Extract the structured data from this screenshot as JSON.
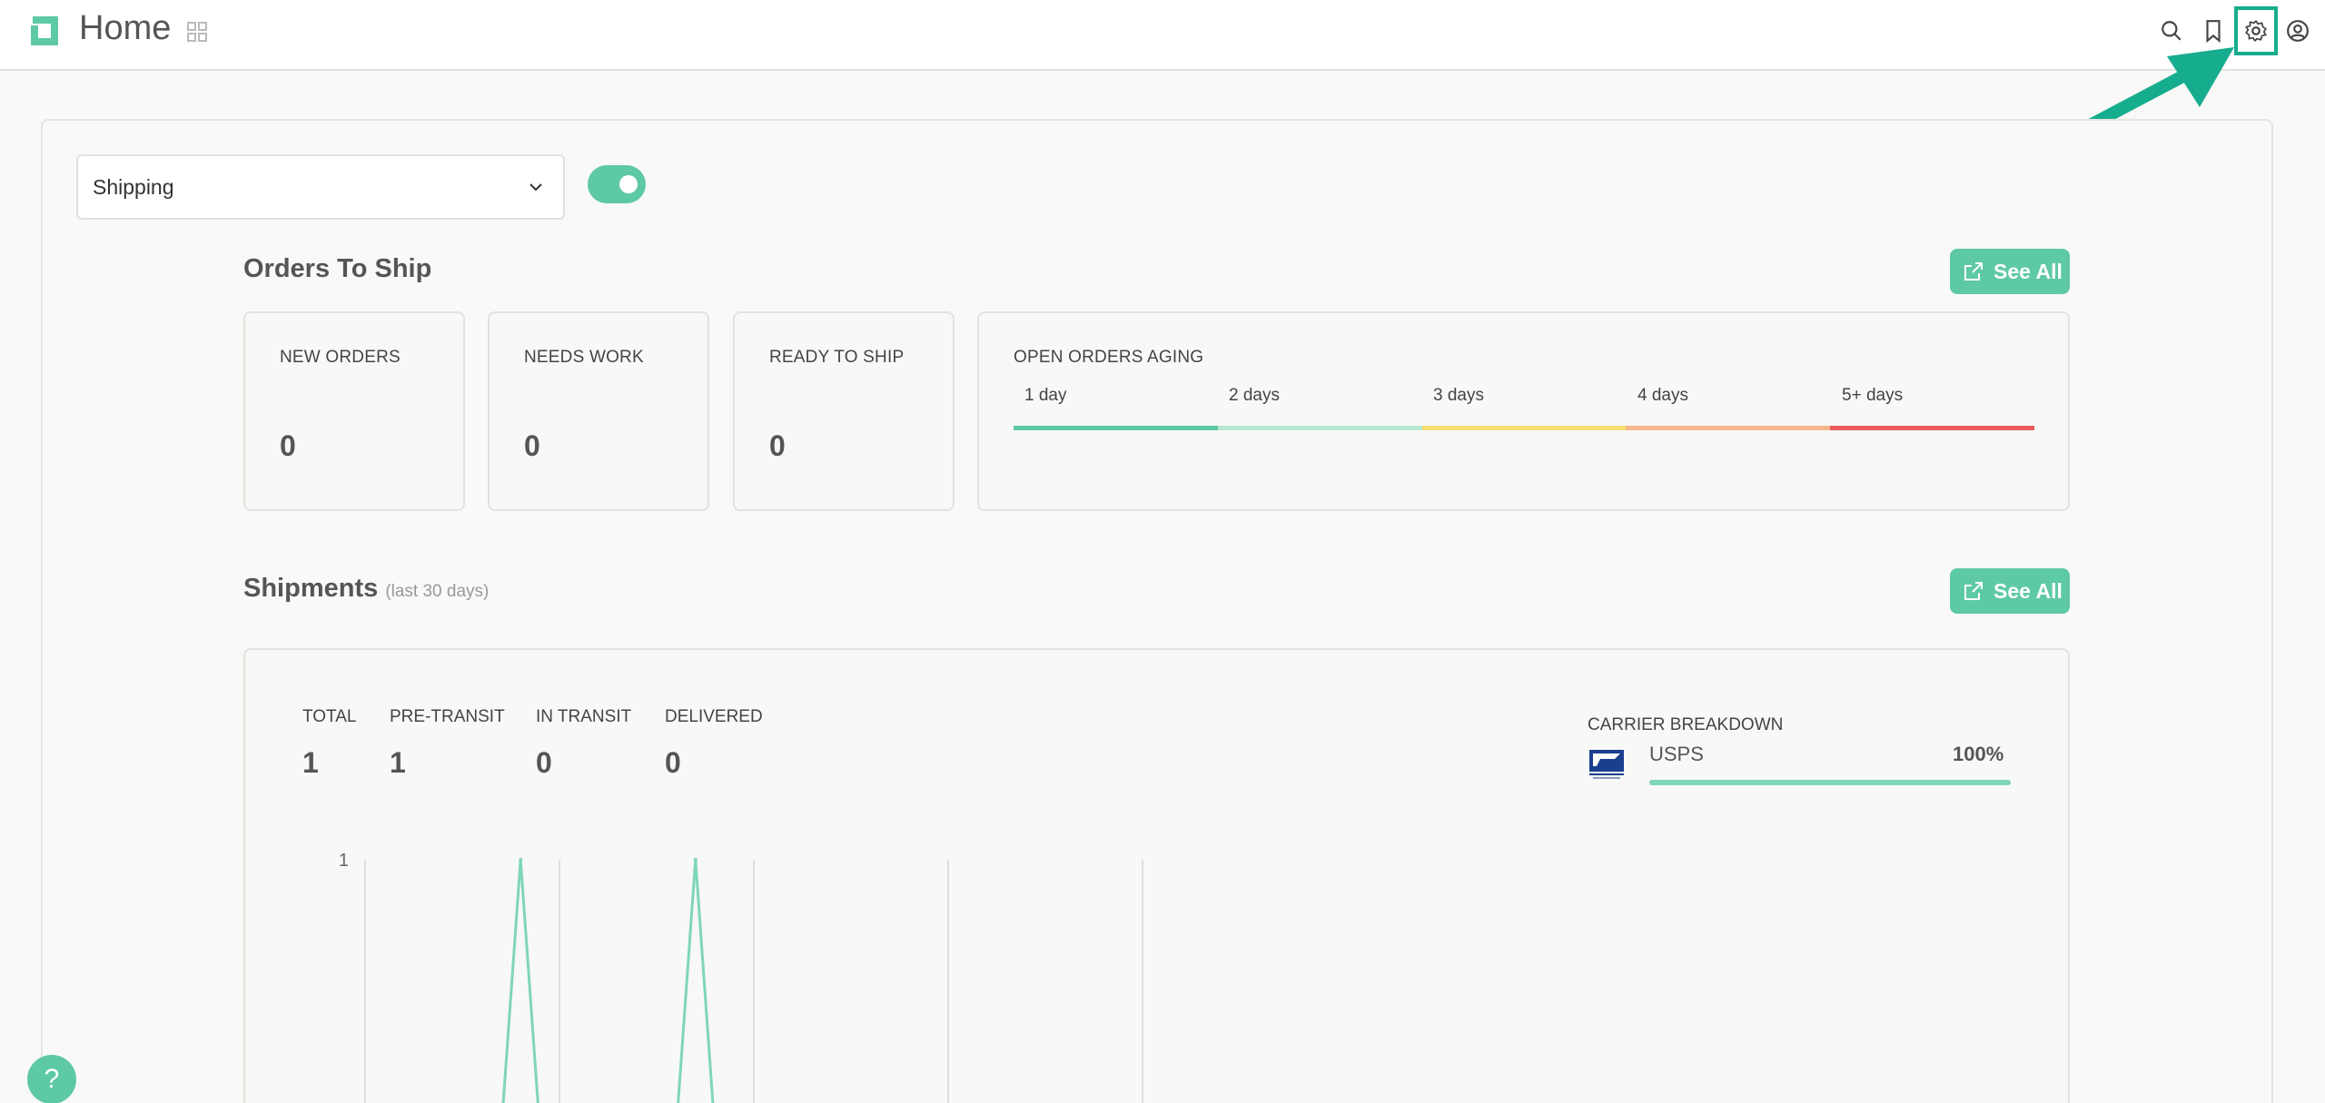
{
  "header": {
    "title": "Home"
  },
  "filters": {
    "module_select": "Shipping",
    "toggle_on": true
  },
  "orders_to_ship": {
    "title": "Orders To Ship",
    "see_all": "See All",
    "cards": [
      {
        "label": "NEW ORDERS",
        "value": "0"
      },
      {
        "label": "NEEDS WORK",
        "value": "0"
      },
      {
        "label": "READY TO SHIP",
        "value": "0"
      }
    ],
    "aging": {
      "label": "OPEN ORDERS AGING",
      "buckets": [
        {
          "label": "1 day",
          "color": "#5ec9a5"
        },
        {
          "label": "2 days",
          "color": "#b6e8d2"
        },
        {
          "label": "3 days",
          "color": "#f6df70"
        },
        {
          "label": "4 days",
          "color": "#f3b78b"
        },
        {
          "label": "5+ days",
          "color": "#e85b5b"
        }
      ]
    }
  },
  "shipments": {
    "title": "Shipments",
    "subtitle": "(last 30 days)",
    "see_all": "See All",
    "stats": [
      {
        "label": "TOTAL",
        "value": "1"
      },
      {
        "label": "PRE-TRANSIT",
        "value": "1"
      },
      {
        "label": "IN TRANSIT",
        "value": "0"
      },
      {
        "label": "DELIVERED",
        "value": "0"
      }
    ],
    "carrier_breakdown": {
      "title": "CARRIER BREAKDOWN",
      "carriers": [
        {
          "name": "USPS",
          "percent": "100%",
          "fraction": 1.0
        }
      ]
    }
  },
  "chart_data": {
    "type": "line",
    "y_tick_labels": [
      "1"
    ],
    "ylim": [
      0,
      1
    ],
    "x_index_range": [
      0,
      30
    ],
    "series": [
      {
        "color": "#7fd6b8",
        "x": [
          0,
          4,
          7,
          8,
          9,
          12,
          16,
          17,
          18,
          30
        ],
        "y": [
          0,
          0,
          0,
          1,
          0,
          0,
          0,
          1,
          0,
          0
        ]
      }
    ]
  },
  "help": {
    "label": "?"
  },
  "colors": {
    "accent": "#5ec9a5",
    "highlight": "#16ad8e"
  },
  "icons": [
    "logo-icon",
    "apps-grid-icon",
    "search-icon",
    "bookmark-icon",
    "gear-icon",
    "user-circle-icon",
    "chevron-down-icon",
    "external-link-icon",
    "usps-logo-icon"
  ]
}
